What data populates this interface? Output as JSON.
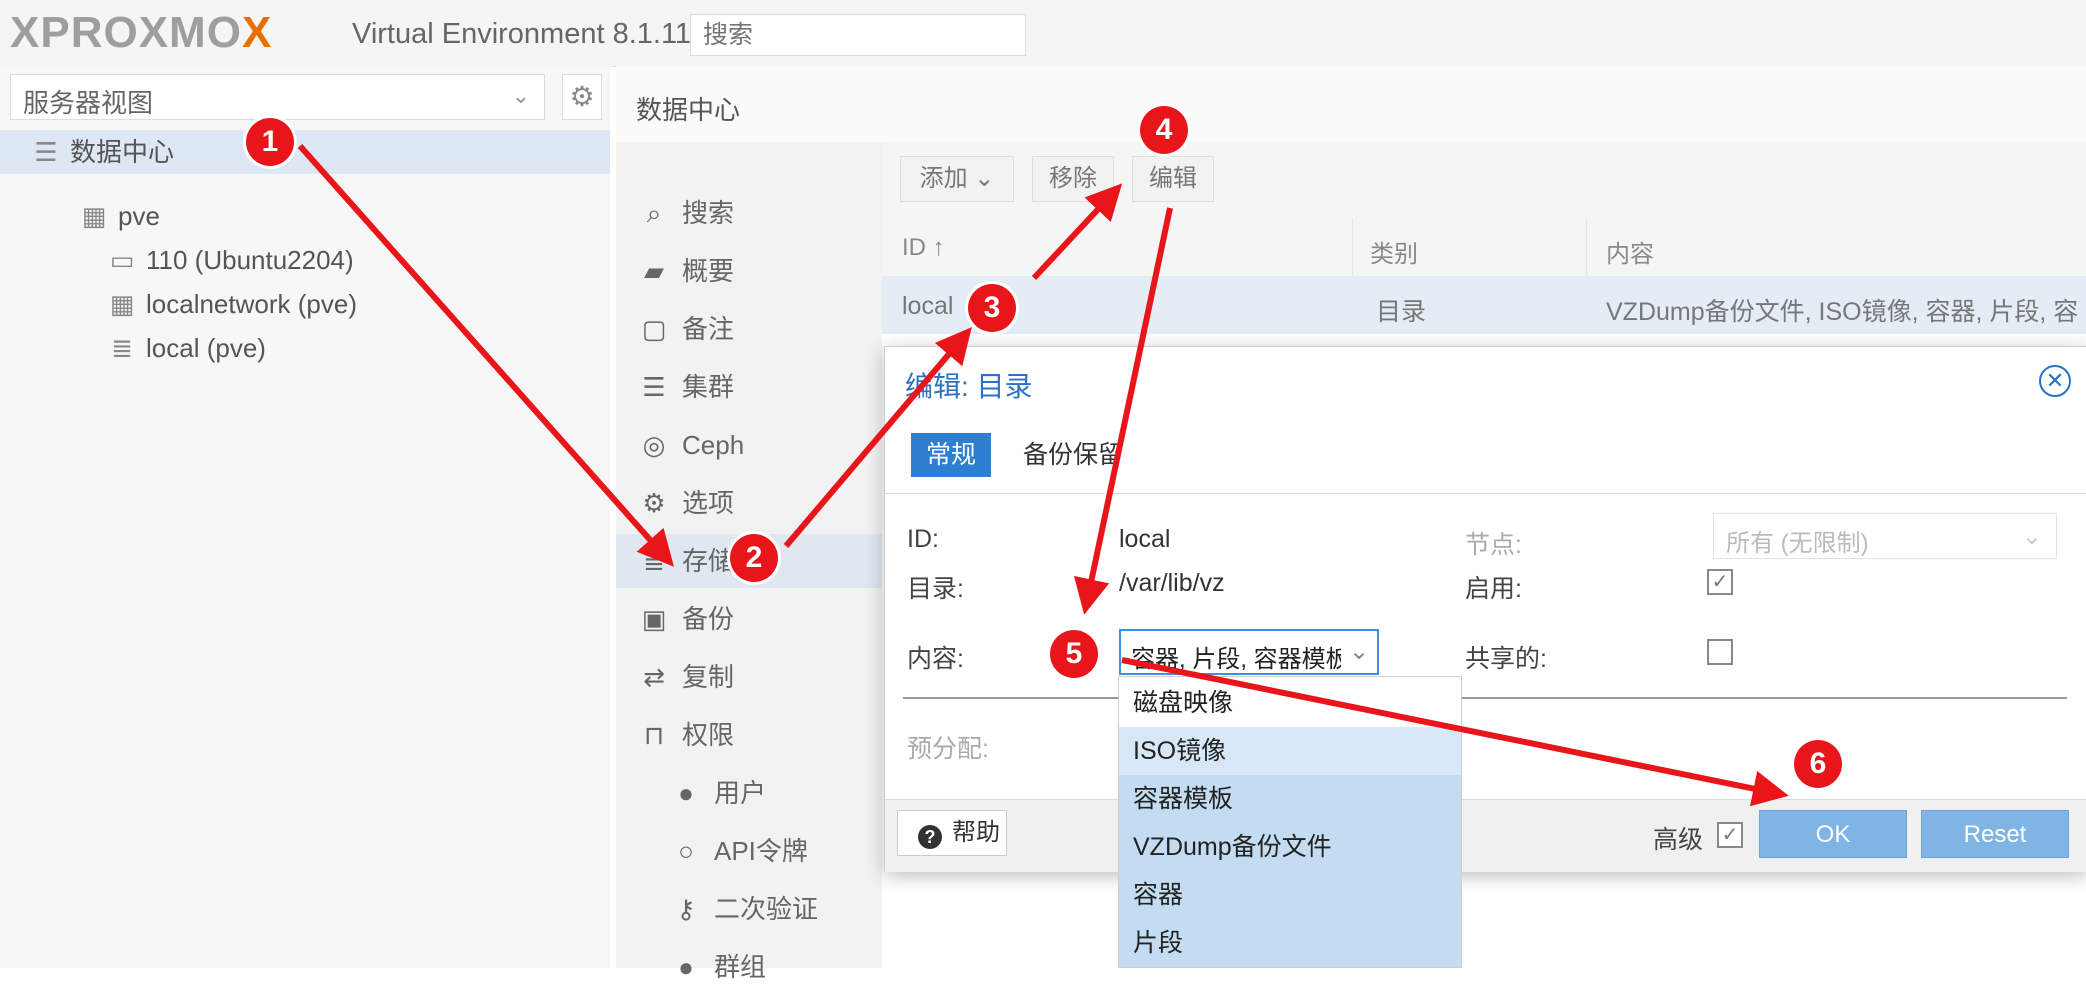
{
  "header": {
    "logo": {
      "part1": "X",
      "part2": "PROXMO",
      "part3": "X"
    },
    "version": "Virtual Environment 8.1.11",
    "search_placeholder": "搜索"
  },
  "left_panel": {
    "view_select": "服务器视图",
    "tree": {
      "datacenter": "数据中心",
      "node": "pve",
      "vm": "110 (Ubuntu2204)",
      "network": "localnetwork (pve)",
      "storage": "local (pve)"
    }
  },
  "main": {
    "title": "数据中心",
    "menu": [
      {
        "label": "搜索",
        "icon": "search-icon"
      },
      {
        "label": "概要",
        "icon": "book-icon"
      },
      {
        "label": "备注",
        "icon": "note-icon"
      },
      {
        "label": "集群",
        "icon": "server-icon"
      },
      {
        "label": "Ceph",
        "icon": "ceph-icon"
      },
      {
        "label": "选项",
        "icon": "gear-icon"
      },
      {
        "label": "存储",
        "icon": "database-icon"
      },
      {
        "label": "备份",
        "icon": "save-icon"
      },
      {
        "label": "复制",
        "icon": "retweet-icon"
      },
      {
        "label": "权限",
        "icon": "unlock-icon"
      },
      {
        "label": "用户",
        "icon": "user-icon"
      },
      {
        "label": "API令牌",
        "icon": "user-outline-icon"
      },
      {
        "label": "二次验证",
        "icon": "key-icon"
      },
      {
        "label": "群组",
        "icon": "users-icon"
      }
    ],
    "toolbar": {
      "add": "添加",
      "remove": "移除",
      "edit": "编辑"
    },
    "grid": {
      "columns": [
        "ID ↑",
        "类别",
        "内容"
      ],
      "rows": [
        {
          "id": "local",
          "type": "目录",
          "content": "VZDump备份文件, ISO镜像, 容器, 片段, 容"
        }
      ]
    }
  },
  "dialog": {
    "title": "编辑: 目录",
    "tabs": [
      "常规",
      "备份保留"
    ],
    "fields": {
      "id_label": "ID:",
      "id_value": "local",
      "dir_label": "目录:",
      "dir_value": "/var/lib/vz",
      "content_label": "内容:",
      "content_value": "容器, 片段, 容器模板, VZ",
      "prealloc_label": "预分配:",
      "node_label": "节点:",
      "node_value": "所有 (无限制)",
      "enable_label": "启用:",
      "enable_checked": true,
      "shared_label": "共享的:",
      "shared_checked": false
    },
    "footer": {
      "help": "帮助",
      "advanced": "高级",
      "ok": "OK",
      "reset": "Reset"
    }
  },
  "dropdown_options": [
    {
      "label": "磁盘映像",
      "selected": false
    },
    {
      "label": "ISO镜像",
      "selected": false
    },
    {
      "label": "容器模板",
      "selected": true
    },
    {
      "label": "VZDump备份文件",
      "selected": true
    },
    {
      "label": "容器",
      "selected": true
    },
    {
      "label": "片段",
      "selected": true
    }
  ],
  "annotations": [
    "1",
    "2",
    "3",
    "4",
    "5",
    "6"
  ],
  "colors": {
    "accent": "#2f7fd0",
    "annotation": "#e8161b",
    "logo_orange": "#e57000"
  }
}
